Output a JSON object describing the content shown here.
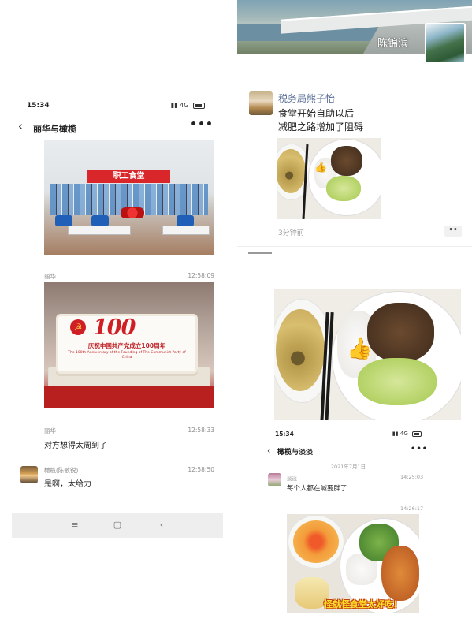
{
  "left_chat": {
    "status_time": "15:34",
    "status_signal": "4G",
    "title": "丽华与橄榄",
    "messages": [
      {
        "sender": "丽华",
        "time": "12:58:09"
      },
      {
        "sender": "丽华",
        "time": "12:58:33",
        "text": "对方想得太周到了"
      },
      {
        "sender": "橄榄(陈敏锐)",
        "time": "12:58:50",
        "text": "是啊，太给力"
      }
    ],
    "canteen_sign": "职工食堂",
    "cake": {
      "number": "100",
      "chinese_text": "庆祝中国共产党成立100周年",
      "english_text": "The 100th Anniversary of the Founding of The Communist Party of China"
    },
    "nav_icons": [
      "menu-icon",
      "home-icon",
      "back-icon"
    ]
  },
  "moments": {
    "cover_name": "陈锦滨",
    "post": {
      "author": "税务局熊子怡",
      "lines": [
        "食堂开始自助以后",
        "减肥之路增加了阻碍"
      ],
      "time": "3分钟前",
      "more": "••"
    }
  },
  "right_chat": {
    "status_time": "15:34",
    "status_signal": "4G",
    "title": "橄榄与淡淡",
    "date": "2021年7月1日",
    "sender": "淡淡",
    "msg_time": "14:25:03",
    "message": "每个人都在喊要胖了",
    "msg_time_2": "14:26:17",
    "image_caption": "怪就怪食堂太好吃！"
  },
  "colors": {
    "link_blue": "#576b95",
    "party_red": "#d01f24",
    "caption_yellow": "#ffde2a"
  }
}
